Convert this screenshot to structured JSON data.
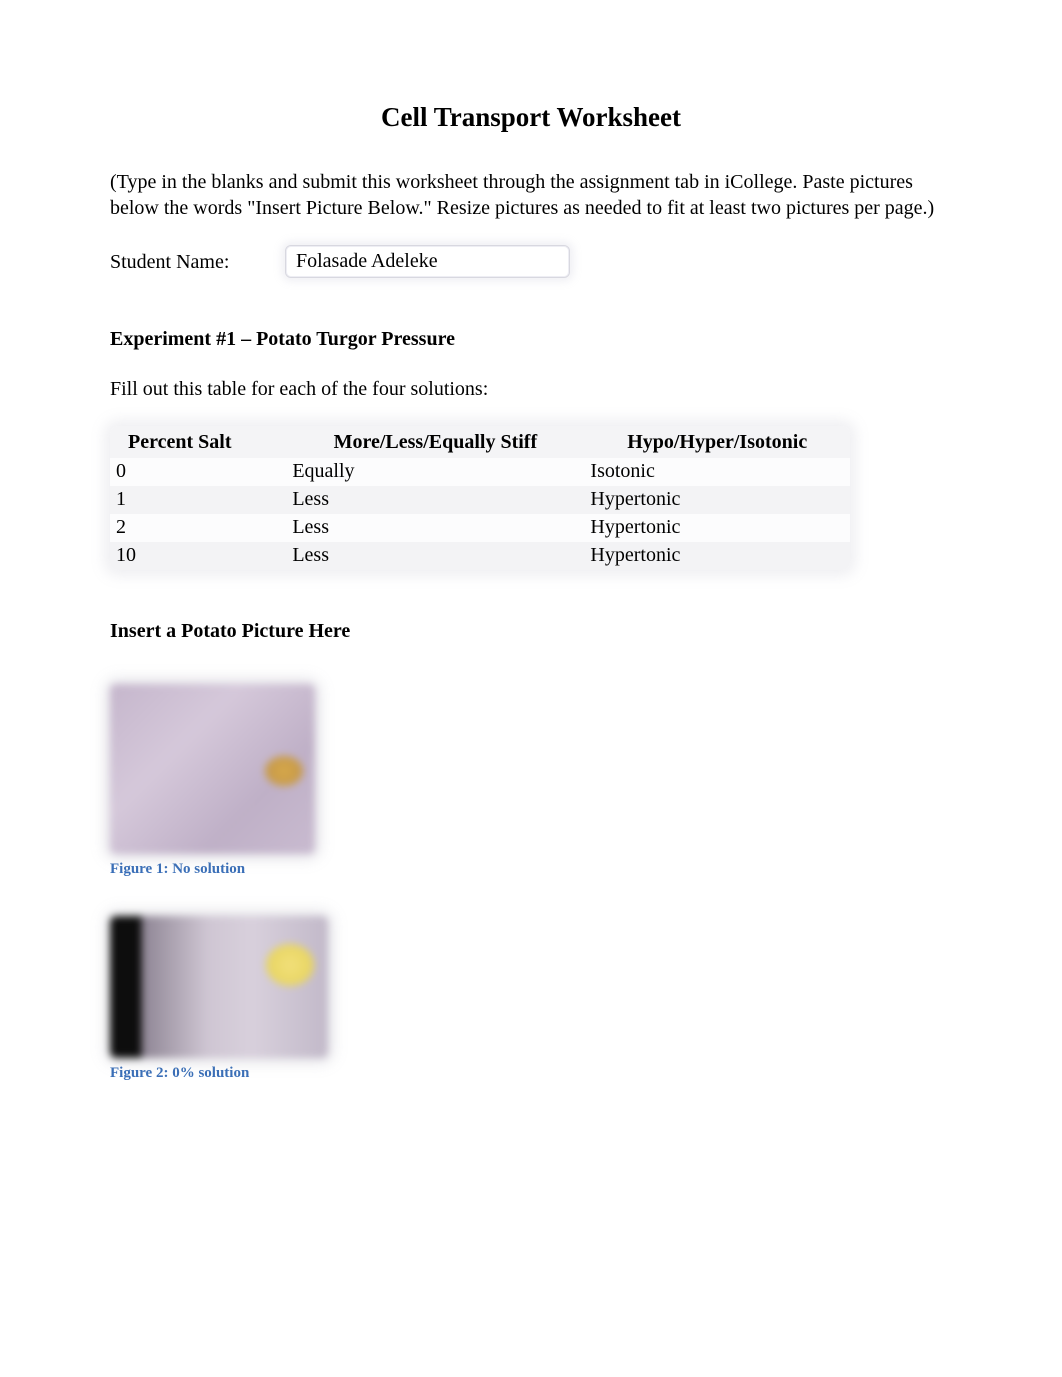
{
  "title": "Cell Transport Worksheet",
  "instructions": "(Type in the blanks and submit this worksheet through the assignment tab in iCollege.  Paste pictures below the words \"Insert Picture Below.\"  Resize pictures as needed to fit at least two pictures per page.)",
  "student": {
    "label": "Student Name:",
    "value": "Folasade Adeleke"
  },
  "experiment1": {
    "heading": "Experiment #1 – Potato Turgor Pressure",
    "subtext": "Fill out this table for each of the four solutions:",
    "table": {
      "headers": [
        "Percent Salt",
        "More/Less/Equally Stiff",
        "Hypo/Hyper/Isotonic"
      ],
      "rows": [
        {
          "percent": "0",
          "stiffness": "Equally",
          "tonicity": "Isotonic"
        },
        {
          "percent": "1",
          "stiffness": "Less",
          "tonicity": "Hypertonic"
        },
        {
          "percent": "2",
          "stiffness": "Less",
          "tonicity": "Hypertonic"
        },
        {
          "percent": "10",
          "stiffness": "Less",
          "tonicity": "Hypertonic"
        }
      ]
    }
  },
  "picture_section": {
    "heading": "Insert a Potato Picture Here",
    "figures": [
      {
        "caption": "Figure 1: No solution"
      },
      {
        "caption": "Figure 2: 0% solution"
      }
    ]
  }
}
